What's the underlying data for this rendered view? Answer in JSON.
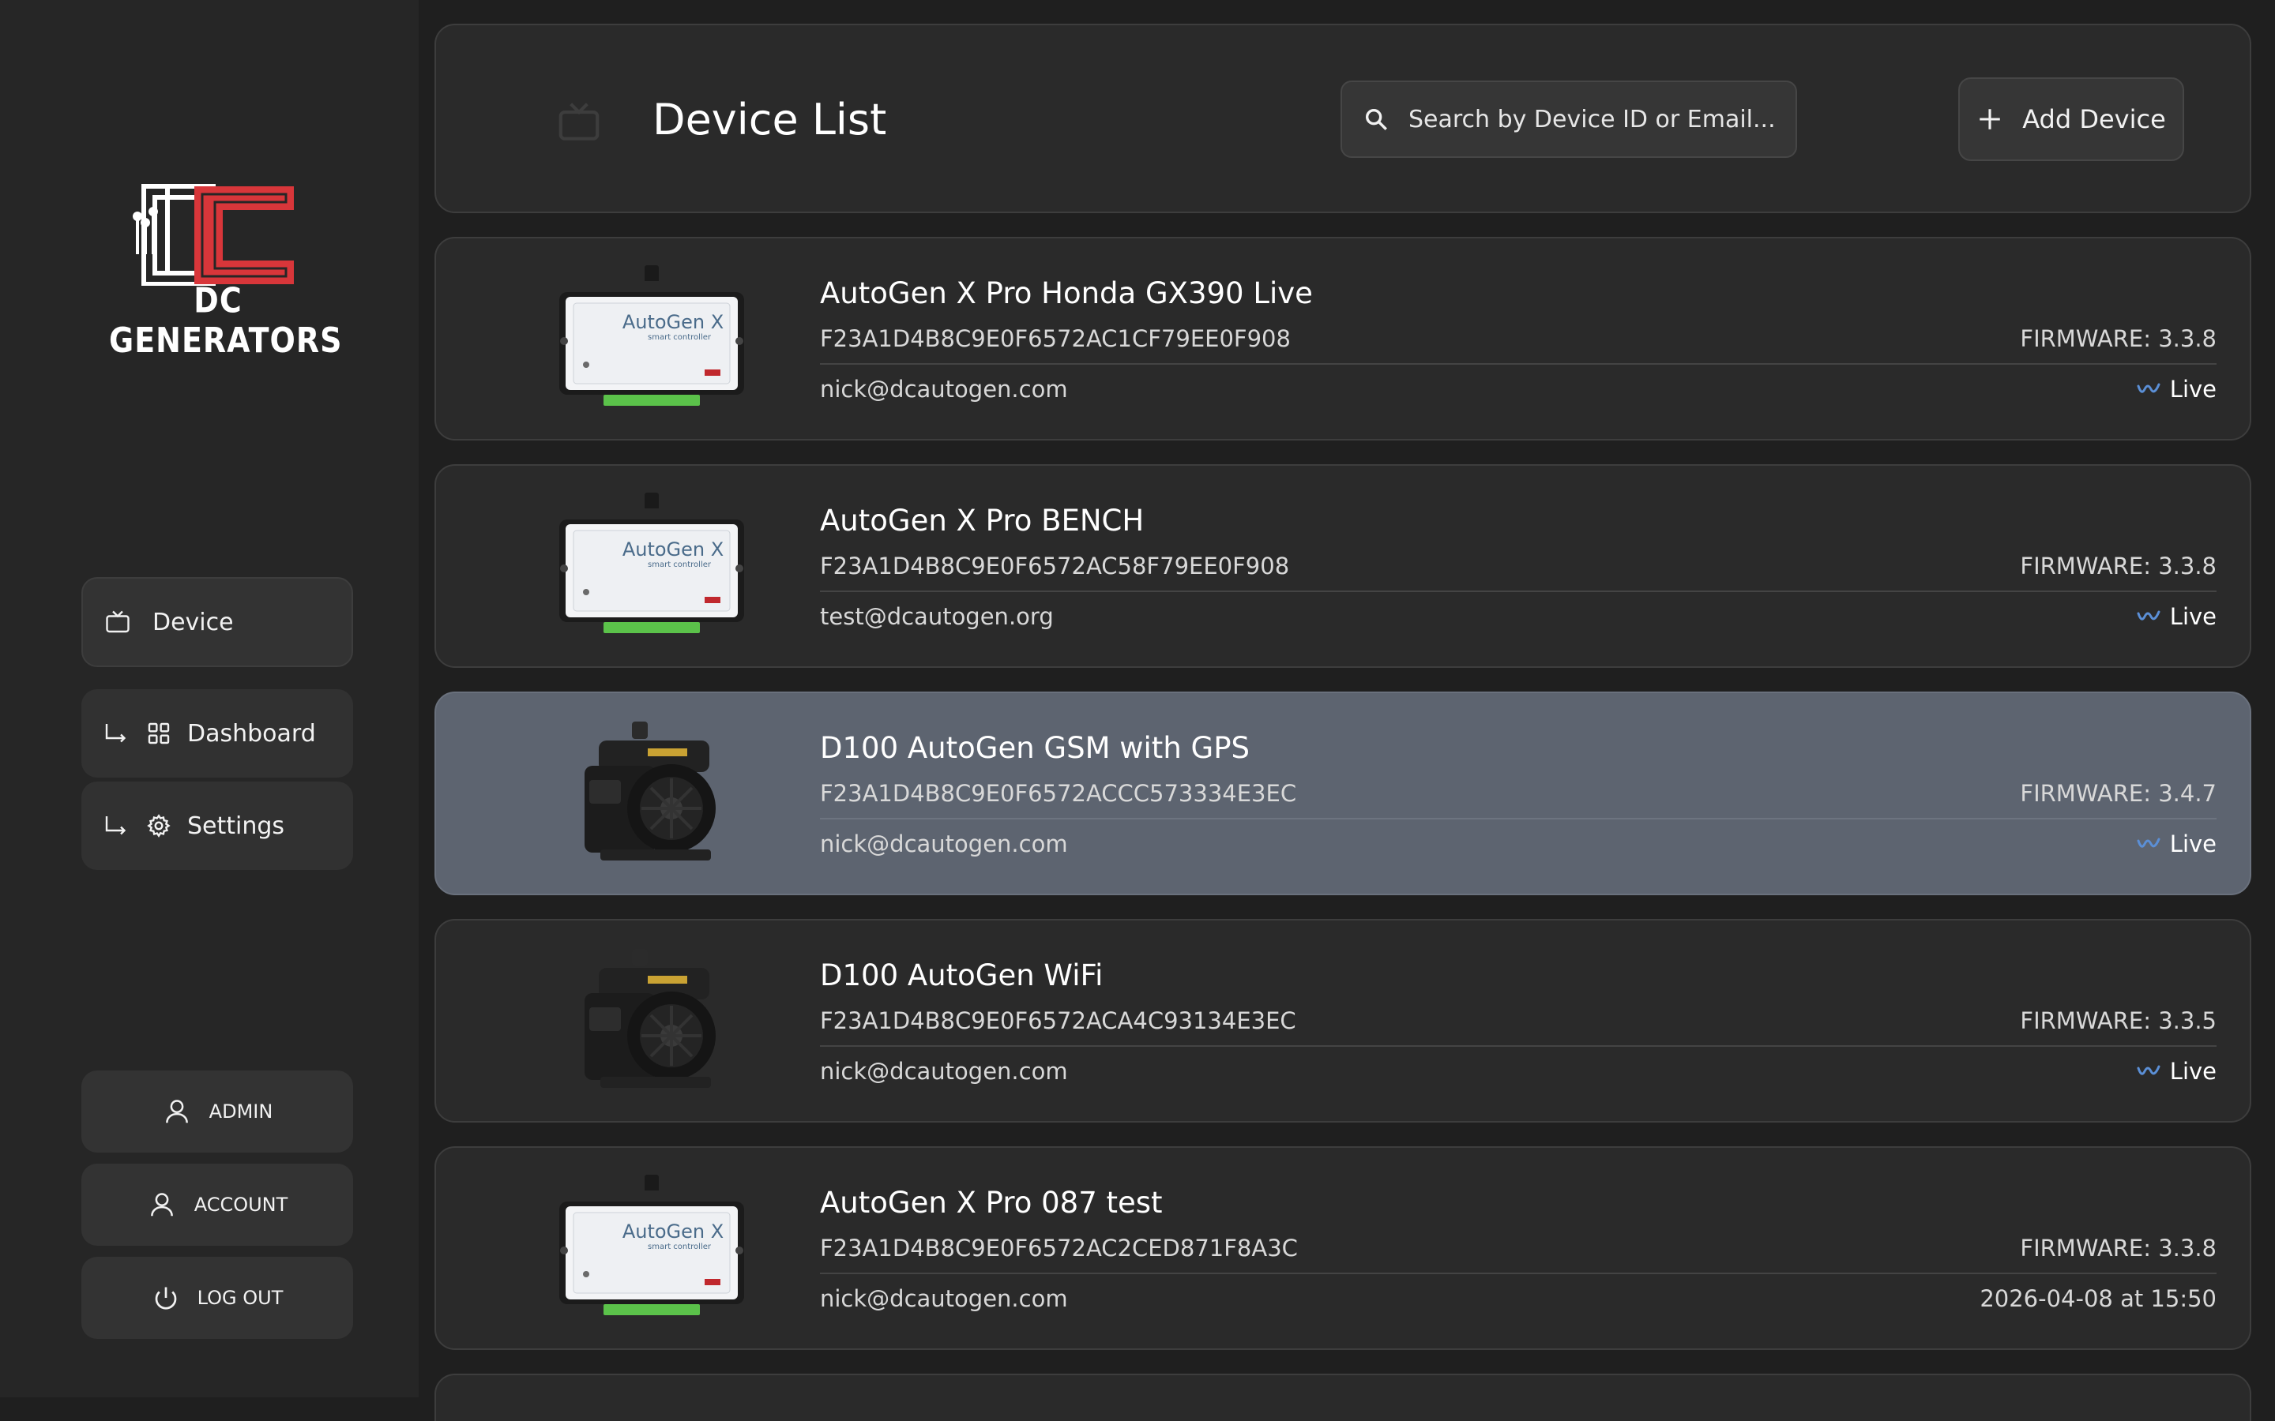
{
  "brand": {
    "name": "DC GENERATORS",
    "accent": "#d8363a"
  },
  "sidebar": {
    "device_label": "Device",
    "dashboard_label": "Dashboard",
    "settings_label": "Settings",
    "admin_label": "ADMIN",
    "account_label": "ACCOUNT",
    "logout_label": "LOG OUT"
  },
  "header": {
    "title": "Device List",
    "search_placeholder": "Search by Device ID or Email...",
    "add_label": "Add Device"
  },
  "devices": [
    {
      "name": "AutoGen X Pro Honda GX390 Live",
      "id": "F23A1D4B8C9E0F6572AC1CF79EE0F908",
      "firmware": "FIRMWARE: 3.3.8",
      "email": "nick@dcautogen.com",
      "status": "Live",
      "thumb": "controller-image"
    },
    {
      "name": "AutoGen X Pro BENCH",
      "id": "F23A1D4B8C9E0F6572AC58F79EE0F908",
      "firmware": "FIRMWARE: 3.3.8",
      "email": "test@dcautogen.org",
      "status": "Live",
      "thumb": "controller-image"
    },
    {
      "name": "D100 AutoGen GSM with GPS",
      "id": "F23A1D4B8C9E0F6572ACCC573334E3EC",
      "firmware": "FIRMWARE: 3.4.7",
      "email": "nick@dcautogen.com",
      "status": "Live",
      "thumb": "engine-image",
      "selected": true
    },
    {
      "name": "D100 AutoGen WiFi",
      "id": "F23A1D4B8C9E0F6572ACA4C93134E3EC",
      "firmware": "FIRMWARE: 3.3.5",
      "email": "nick@dcautogen.com",
      "status": "Live",
      "thumb": "engine-image"
    },
    {
      "name": "AutoGen X Pro 087 test",
      "id": "F23A1D4B8C9E0F6572AC2CED871F8A3C",
      "firmware": "FIRMWARE: 3.3.8",
      "email": "nick@dcautogen.com",
      "status": "2026-04-08 at 15:50",
      "thumb": "controller-image"
    }
  ],
  "thumb_label": "AutoGen X",
  "thumb_sublabel": "smart controller",
  "colors": {
    "live_icon": "#5b8fd6",
    "selected_card": "#5d6470"
  }
}
